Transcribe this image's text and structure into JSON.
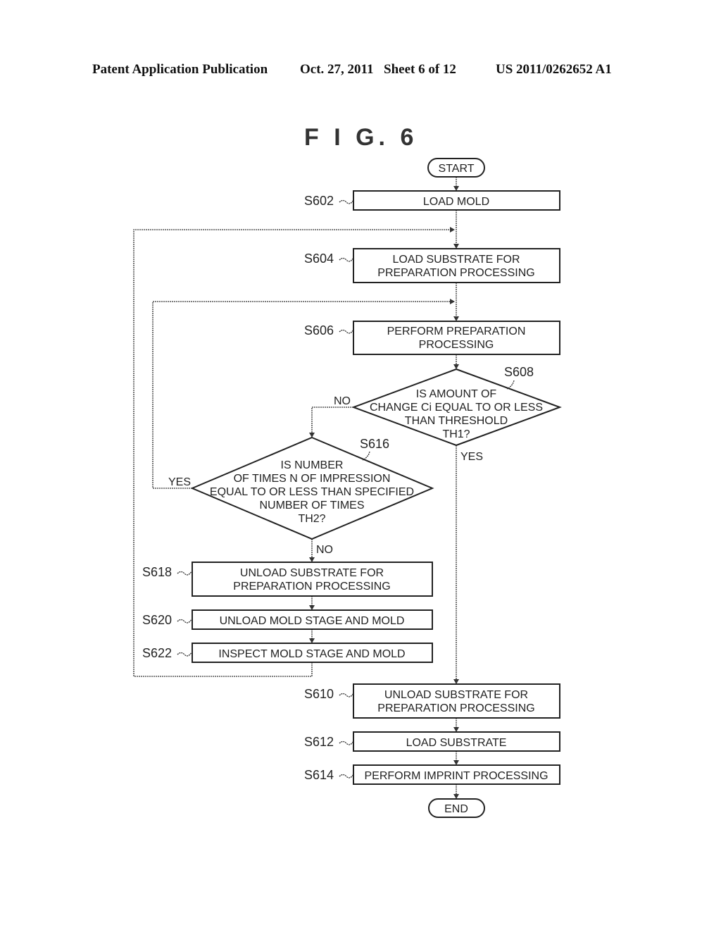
{
  "header": {
    "publication": "Patent Application Publication",
    "date": "Oct. 27, 2011",
    "sheet": "Sheet 6 of 12",
    "number": "US 2011/0262652 A1"
  },
  "figure": {
    "title": "F I G. 6"
  },
  "flowchart": {
    "start": "START",
    "end": "END",
    "steps": {
      "s602": {
        "id": "S602",
        "lines": [
          "LOAD MOLD"
        ]
      },
      "s604": {
        "id": "S604",
        "lines": [
          "LOAD SUBSTRATE FOR",
          "PREPARATION PROCESSING"
        ]
      },
      "s606": {
        "id": "S606",
        "lines": [
          "PERFORM PREPARATION",
          "PROCESSING"
        ]
      },
      "s608": {
        "id": "S608",
        "lines": [
          "IS AMOUNT OF",
          "CHANGE Ci EQUAL TO OR LESS",
          "THAN THRESHOLD",
          "TH1?"
        ]
      },
      "s616": {
        "id": "S616",
        "lines": [
          "IS NUMBER",
          "OF TIMES N OF IMPRESSION",
          "EQUAL TO OR LESS THAN SPECIFIED",
          "NUMBER OF TIMES",
          "TH2?"
        ]
      },
      "s618": {
        "id": "S618",
        "lines": [
          "UNLOAD SUBSTRATE FOR",
          "PREPARATION PROCESSING"
        ]
      },
      "s620": {
        "id": "S620",
        "lines": [
          "UNLOAD MOLD STAGE AND MOLD"
        ]
      },
      "s622": {
        "id": "S622",
        "lines": [
          "INSPECT MOLD STAGE AND MOLD"
        ]
      },
      "s610": {
        "id": "S610",
        "lines": [
          "UNLOAD SUBSTRATE FOR",
          "PREPARATION PROCESSING"
        ]
      },
      "s612": {
        "id": "S612",
        "lines": [
          "LOAD SUBSTRATE"
        ]
      },
      "s614": {
        "id": "S614",
        "lines": [
          "PERFORM IMPRINT PROCESSING"
        ]
      }
    },
    "branch_labels": {
      "s608_no": "NO",
      "s608_yes": "YES",
      "s616_yes": "YES",
      "s616_no": "NO"
    }
  }
}
